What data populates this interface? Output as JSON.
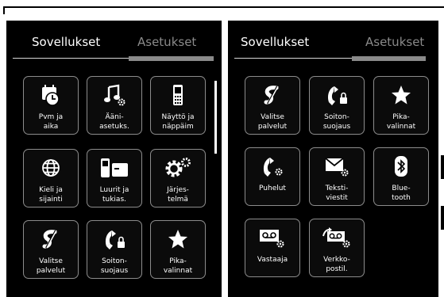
{
  "colors": {
    "screen_bg": "#000000",
    "text": "#ffffff",
    "inactive_text": "#8a8a8a",
    "tile_border": "#8c8c8c"
  },
  "left_panel": {
    "tabs": [
      {
        "label": "Sovellukset",
        "active": true
      },
      {
        "label": "Asetukset",
        "active": false
      }
    ],
    "tiles": [
      {
        "label": "Pvm ja\naika",
        "icon": "calendar-clock-icon"
      },
      {
        "label": "Ääni-\nasetuks.",
        "icon": "music-settings-icon"
      },
      {
        "label": "Näyttö ja\nnäppäim",
        "icon": "handset-display-icon"
      },
      {
        "label": "Kieli ja\nsijainti",
        "icon": "globe-icon"
      },
      {
        "label": "Luurit ja\ntukias.",
        "icon": "handset-base-icon"
      },
      {
        "label": "Järjes-\ntelmä",
        "icon": "system-gears-icon"
      },
      {
        "label": "Valitse\npalvelut",
        "icon": "select-services-icon"
      },
      {
        "label": "Soiton-\nsuojaus",
        "icon": "call-protection-icon"
      },
      {
        "label": "Pika-\nvalinnat",
        "icon": "star-icon"
      }
    ]
  },
  "right_panel": {
    "tabs": [
      {
        "label": "Sovellukset",
        "active": true
      },
      {
        "label": "Asetukset",
        "active": false
      }
    ],
    "tiles": [
      {
        "label": "Valitse\npalvelut",
        "icon": "select-services-icon"
      },
      {
        "label": "Soiton-\nsuojaus",
        "icon": "call-protection-icon"
      },
      {
        "label": "Pika-\nvalinnat",
        "icon": "star-icon"
      },
      {
        "label": "Puhelut",
        "icon": "phone-settings-icon"
      },
      {
        "label": "Teksti-\nviestit",
        "icon": "envelope-settings-icon"
      },
      {
        "label": "Blue-\ntooth",
        "icon": "bluetooth-icon"
      },
      {
        "label": "Vastaaja",
        "icon": "voicemail-settings-icon"
      },
      {
        "label": "Verkko-\npostil.",
        "icon": "network-mailbox-icon"
      }
    ]
  }
}
